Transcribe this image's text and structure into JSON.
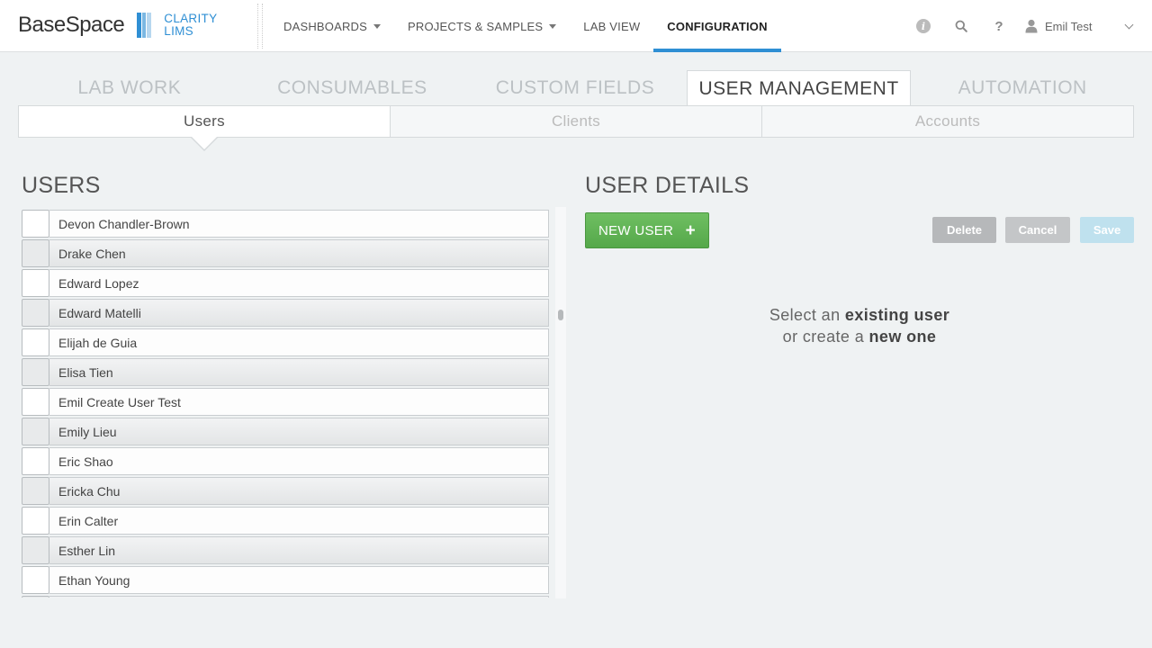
{
  "brand": {
    "name": "BaseSpace",
    "product_line1": "CLARITY",
    "product_line2": "LIMS"
  },
  "nav": {
    "items": [
      {
        "label": "DASHBOARDS",
        "dropdown": true
      },
      {
        "label": "PROJECTS & SAMPLES",
        "dropdown": true
      },
      {
        "label": "LAB VIEW",
        "dropdown": false
      },
      {
        "label": "CONFIGURATION",
        "dropdown": false,
        "active": true
      }
    ]
  },
  "toolbar": {
    "info_icon": "info-icon",
    "search_icon": "search-icon",
    "help_icon": "help-icon",
    "user_name": "Emil Test"
  },
  "config_tabs": [
    "LAB WORK",
    "CONSUMABLES",
    "CUSTOM FIELDS",
    "USER MANAGEMENT",
    "AUTOMATION"
  ],
  "config_active": "USER MANAGEMENT",
  "sub_tabs": [
    "Users",
    "Clients",
    "Accounts"
  ],
  "sub_active": "Users",
  "users_section": {
    "title": "USERS",
    "users": [
      "Devon Chandler-Brown",
      "Drake Chen",
      "Edward Lopez",
      "Edward Matelli",
      "Elijah de Guia",
      "Elisa Tien",
      "Emil Create User Test",
      "Emily Lieu",
      "Eric Shao",
      "Ericka Chu",
      "Erin Calter",
      "Esther Lin",
      "Ethan Young",
      ""
    ]
  },
  "details_section": {
    "title": "USER DETAILS",
    "new_user_label": "NEW USER",
    "delete_label": "Delete",
    "cancel_label": "Cancel",
    "save_label": "Save",
    "empty_line1_prefix": "Select an ",
    "empty_line1_bold": "existing user",
    "empty_line2_prefix": "or create a ",
    "empty_line2_bold": "new one"
  },
  "colors": {
    "accent": "#2f8fd4",
    "new_button": "#5fb354",
    "background": "#eff2f3"
  }
}
